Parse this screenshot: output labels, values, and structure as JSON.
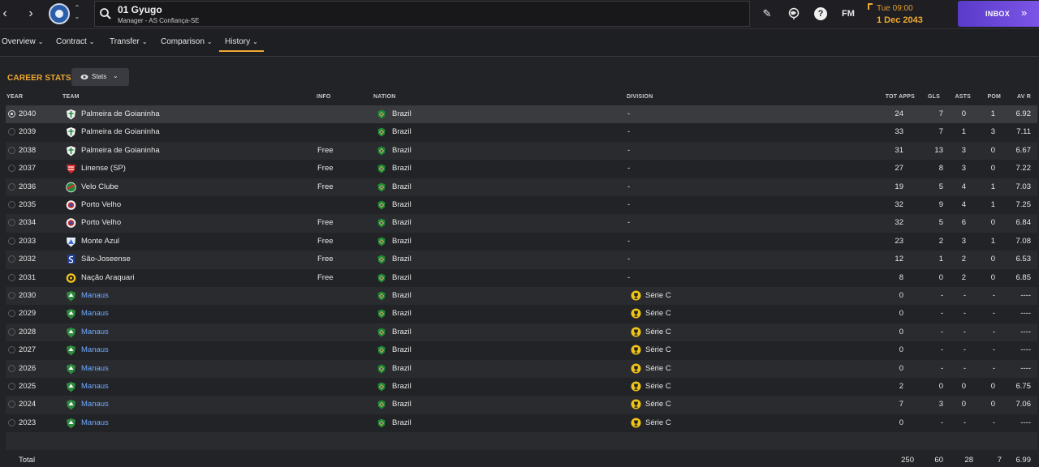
{
  "header": {
    "person_name": "01 Gyugo",
    "person_subtitle": "Manager - AS Confiança-SE",
    "time": "Tue 09:00",
    "date": "1 Dec 2043",
    "fm_label": "FM",
    "inbox_label": "INBOX",
    "help_label": "?"
  },
  "tabs": [
    {
      "label": "Overview"
    },
    {
      "label": "Contract"
    },
    {
      "label": "Transfer"
    },
    {
      "label": "Comparison"
    },
    {
      "label": "History",
      "active": true
    }
  ],
  "section": {
    "title": "CAREER STATS",
    "view_button": "Stats"
  },
  "columns": {
    "year": "YEAR",
    "team": "TEAM",
    "info": "INFO",
    "nation": "NATION",
    "division": "DIVISION",
    "apps": "TOT APPS",
    "gls": "GLS",
    "asts": "ASTS",
    "pom": "POM",
    "avr": "AV R"
  },
  "rows": [
    {
      "year": "2040",
      "team": "Palmeira de Goianinha",
      "team_link": false,
      "info": "",
      "nation": "Brazil",
      "division": "-",
      "apps": "24",
      "gls": "7",
      "asts": "0",
      "pom": "1",
      "avr": "6.92",
      "badge": "palmeira"
    },
    {
      "year": "2039",
      "team": "Palmeira de Goianinha",
      "team_link": false,
      "info": "",
      "nation": "Brazil",
      "division": "-",
      "apps": "33",
      "gls": "7",
      "asts": "1",
      "pom": "3",
      "avr": "7.11",
      "badge": "palmeira"
    },
    {
      "year": "2038",
      "team": "Palmeira de Goianinha",
      "team_link": false,
      "info": "Free",
      "nation": "Brazil",
      "division": "-",
      "apps": "31",
      "gls": "13",
      "asts": "3",
      "pom": "0",
      "avr": "6.67",
      "badge": "palmeira"
    },
    {
      "year": "2037",
      "team": "Linense (SP)",
      "team_link": false,
      "info": "Free",
      "nation": "Brazil",
      "division": "-",
      "apps": "27",
      "gls": "8",
      "asts": "3",
      "pom": "0",
      "avr": "7.22",
      "badge": "linense"
    },
    {
      "year": "2036",
      "team": "Velo Clube",
      "team_link": false,
      "info": "Free",
      "nation": "Brazil",
      "division": "-",
      "apps": "19",
      "gls": "5",
      "asts": "4",
      "pom": "1",
      "avr": "7.03",
      "badge": "velo"
    },
    {
      "year": "2035",
      "team": "Porto Velho",
      "team_link": false,
      "info": "",
      "nation": "Brazil",
      "division": "-",
      "apps": "32",
      "gls": "9",
      "asts": "4",
      "pom": "1",
      "avr": "7.25",
      "badge": "porto"
    },
    {
      "year": "2034",
      "team": "Porto Velho",
      "team_link": false,
      "info": "Free",
      "nation": "Brazil",
      "division": "-",
      "apps": "32",
      "gls": "5",
      "asts": "6",
      "pom": "0",
      "avr": "6.84",
      "badge": "porto"
    },
    {
      "year": "2033",
      "team": "Monte Azul",
      "team_link": false,
      "info": "Free",
      "nation": "Brazil",
      "division": "-",
      "apps": "23",
      "gls": "2",
      "asts": "3",
      "pom": "1",
      "avr": "7.08",
      "badge": "monte"
    },
    {
      "year": "2032",
      "team": "São-Joseense",
      "team_link": false,
      "info": "Free",
      "nation": "Brazil",
      "division": "-",
      "apps": "12",
      "gls": "1",
      "asts": "2",
      "pom": "0",
      "avr": "6.53",
      "badge": "joseense"
    },
    {
      "year": "2031",
      "team": "Nação Araquari",
      "team_link": false,
      "info": "Free",
      "nation": "Brazil",
      "division": "-",
      "apps": "8",
      "gls": "0",
      "asts": "2",
      "pom": "0",
      "avr": "6.85",
      "badge": "nacao"
    },
    {
      "year": "2030",
      "team": "Manaus",
      "team_link": true,
      "info": "",
      "nation": "Brazil",
      "division": "Série C",
      "apps": "0",
      "gls": "-",
      "asts": "-",
      "pom": "-",
      "avr": "----",
      "badge": "manaus"
    },
    {
      "year": "2029",
      "team": "Manaus",
      "team_link": true,
      "info": "",
      "nation": "Brazil",
      "division": "Série C",
      "apps": "0",
      "gls": "-",
      "asts": "-",
      "pom": "-",
      "avr": "----",
      "badge": "manaus"
    },
    {
      "year": "2028",
      "team": "Manaus",
      "team_link": true,
      "info": "",
      "nation": "Brazil",
      "division": "Série C",
      "apps": "0",
      "gls": "-",
      "asts": "-",
      "pom": "-",
      "avr": "----",
      "badge": "manaus"
    },
    {
      "year": "2027",
      "team": "Manaus",
      "team_link": true,
      "info": "",
      "nation": "Brazil",
      "division": "Série C",
      "apps": "0",
      "gls": "-",
      "asts": "-",
      "pom": "-",
      "avr": "----",
      "badge": "manaus"
    },
    {
      "year": "2026",
      "team": "Manaus",
      "team_link": true,
      "info": "",
      "nation": "Brazil",
      "division": "Série C",
      "apps": "0",
      "gls": "-",
      "asts": "-",
      "pom": "-",
      "avr": "----",
      "badge": "manaus"
    },
    {
      "year": "2025",
      "team": "Manaus",
      "team_link": true,
      "info": "",
      "nation": "Brazil",
      "division": "Série C",
      "apps": "2",
      "gls": "0",
      "asts": "0",
      "pom": "0",
      "avr": "6.75",
      "badge": "manaus"
    },
    {
      "year": "2024",
      "team": "Manaus",
      "team_link": true,
      "info": "",
      "nation": "Brazil",
      "division": "Série C",
      "apps": "7",
      "gls": "3",
      "asts": "0",
      "pom": "0",
      "avr": "7.06",
      "badge": "manaus"
    },
    {
      "year": "2023",
      "team": "Manaus",
      "team_link": true,
      "info": "",
      "nation": "Brazil",
      "division": "Série C",
      "apps": "0",
      "gls": "-",
      "asts": "-",
      "pom": "-",
      "avr": "----",
      "badge": "manaus"
    }
  ],
  "total": {
    "label": "Total",
    "apps": "250",
    "gls": "60",
    "asts": "28",
    "pom": "7",
    "avr": "6.99"
  },
  "colors": {
    "accent_orange": "#f0a830",
    "inbox_purple": "#6a48da",
    "link_blue": "#6fa8ff"
  }
}
